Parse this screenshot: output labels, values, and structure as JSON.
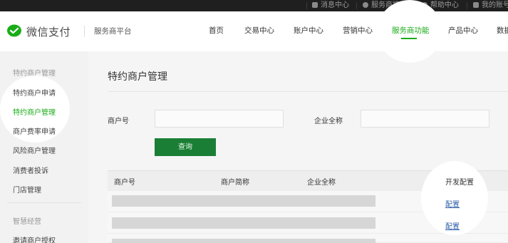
{
  "topbar": {
    "items": [
      {
        "label": "消息中心",
        "icon": "mail-icon"
      },
      {
        "label": "服务商搜索",
        "icon": "search-icon"
      },
      {
        "label": "帮助中心",
        "icon": "help-icon"
      },
      {
        "label": "我的账号",
        "icon": "user-icon"
      }
    ]
  },
  "header": {
    "logo_text": "微信支付",
    "platform": "服务商平台",
    "nav": [
      {
        "label": "首页"
      },
      {
        "label": "交易中心"
      },
      {
        "label": "账户中心"
      },
      {
        "label": "营销中心"
      },
      {
        "label": "服务商功能",
        "active": true
      },
      {
        "label": "产品中心"
      },
      {
        "label": "数据"
      }
    ]
  },
  "sidebar": {
    "section1_title": "特约商户管理",
    "items1": [
      {
        "label": "特约商户申请"
      },
      {
        "label": "特约商户管理",
        "active": true
      },
      {
        "label": "商户费率申请"
      },
      {
        "label": "风险商户管理"
      },
      {
        "label": "消费者投诉"
      },
      {
        "label": "门店管理"
      }
    ],
    "section2_title": "智慧经营",
    "items2": [
      {
        "label": "邀请商户授权"
      }
    ]
  },
  "main": {
    "title": "特约商户管理",
    "filters": {
      "merchant_no_label": "商户号",
      "merchant_no_value": "",
      "company_label": "企业全称",
      "company_value": ""
    },
    "query_button": "查询",
    "table": {
      "columns": [
        "商户号",
        "商户简称",
        "企业全称",
        "开发配置"
      ],
      "rows": [
        {
          "action": "配置"
        },
        {
          "action": "配置"
        }
      ]
    }
  },
  "colors": {
    "accent": "#1aad19",
    "topbar": "#1f1f1f",
    "link": "#2e5ea8"
  }
}
